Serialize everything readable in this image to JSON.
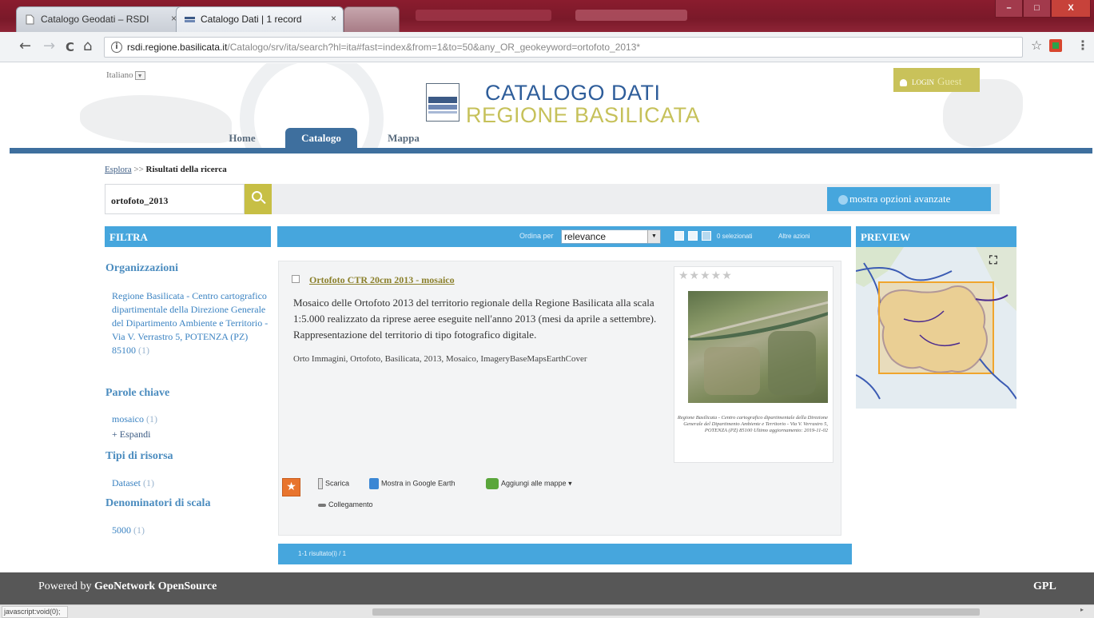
{
  "browser": {
    "tabs": [
      {
        "label": "Catalogo Geodati – RSDI",
        "close": "×",
        "active": false
      },
      {
        "label": "Catalogo Dati | 1 record",
        "close": "×",
        "active": true
      }
    ],
    "window_buttons": {
      "minimize": "–",
      "maximize": "□",
      "close": "X"
    },
    "nav": {
      "back": "←",
      "forward": "→",
      "reload": "C",
      "home": "⌂"
    },
    "url_host": "rsdi.regione.basilicata.it",
    "url_path": "/Catalogo/srv/ita/search?hl=ita#fast=index&from=1&to=50&any_OR_geokeyword=ortofoto_2013*",
    "url_info_icon": "i",
    "bookmark_star": "☆",
    "menu": "⋮",
    "status_text": "javascript:void(0);"
  },
  "header": {
    "language": "Italiano",
    "title_line1": "CATALOGO DATI",
    "title_line2": "REGIONE BASILICATA",
    "login_label": "LOGIN",
    "login_user": "Guest",
    "nav_tabs": {
      "home": "Home",
      "catalog": "Catalogo",
      "map": "Mappa"
    }
  },
  "breadcrumb": {
    "link": "Esplora",
    "separator": ">>",
    "current": "Risultati della ricerca"
  },
  "search": {
    "value": "ortofoto_2013",
    "advanced_label": "mostra opzioni avanzate"
  },
  "filter": {
    "title": "FILTRA",
    "sections": {
      "organizations": "Organizzazioni",
      "keywords": "Parole chiave",
      "resource_types": "Tipi di risorsa",
      "scale": "Denominatori di scala"
    },
    "org_item": "Regione Basilicata - Centro cartografico dipartimentale della Direzione Generale del Dipartimento Ambiente e Territorio - Via V. Verrastro 5, POTENZA (PZ) 85100",
    "org_count": "(1)",
    "keyword_item": "mosaico",
    "keyword_count": "(1)",
    "expand": "+ Espandi",
    "type_item": "Dataset",
    "type_count": "(1)",
    "scale_item": "5000",
    "scale_count": "(1)"
  },
  "sortbar": {
    "order_label": "Ordina per",
    "order_value": "relevance",
    "selected": "0 selezionati",
    "other_actions": "Altre azioni"
  },
  "result": {
    "title": "Ortofoto CTR 20cm 2013 - mosaico",
    "description": "Mosaico delle Ortofoto 2013 del territorio regionale della Regione Basilicata alla scala 1:5.000 realizzato da riprese aeree eseguite nell'anno 2013 (mesi da aprile a settembre). Rappresentazione del territorio di tipo fotografico digitale.",
    "keywords": "Orto Immagini, Ortofoto, Basilicata, 2013, Mosaico, ImageryBaseMapsEarthCover",
    "rating": "★★★★★",
    "thumb_caption": "Regione Basilicata - Centro cartografico dipartimentale della Direzione Generale del Dipartimento Ambiente e Territorio - Via V. Verrastro 5, POTENZA (PZ) 85100 Ultimo aggiornamento: 2019-11-02",
    "actions": {
      "download": "Scarica",
      "google_earth": "Mostra in Google Earth",
      "add_to_map": "Aggiungi alle mappe",
      "link": "Collegamento"
    }
  },
  "pager": {
    "text": "1-1 risultato(i) / 1"
  },
  "preview": {
    "title": "PREVIEW",
    "fullscreen_icon": "⛶"
  },
  "footer": {
    "powered_prefix": "Powered by",
    "powered_name": "GeoNetwork OpenSource",
    "license": "GPL"
  },
  "colors": {
    "accent": "#46a6dd",
    "header_blue": "#3e6f9e",
    "gold": "#c9c25a",
    "browser_frame": "#8a1c2e"
  }
}
